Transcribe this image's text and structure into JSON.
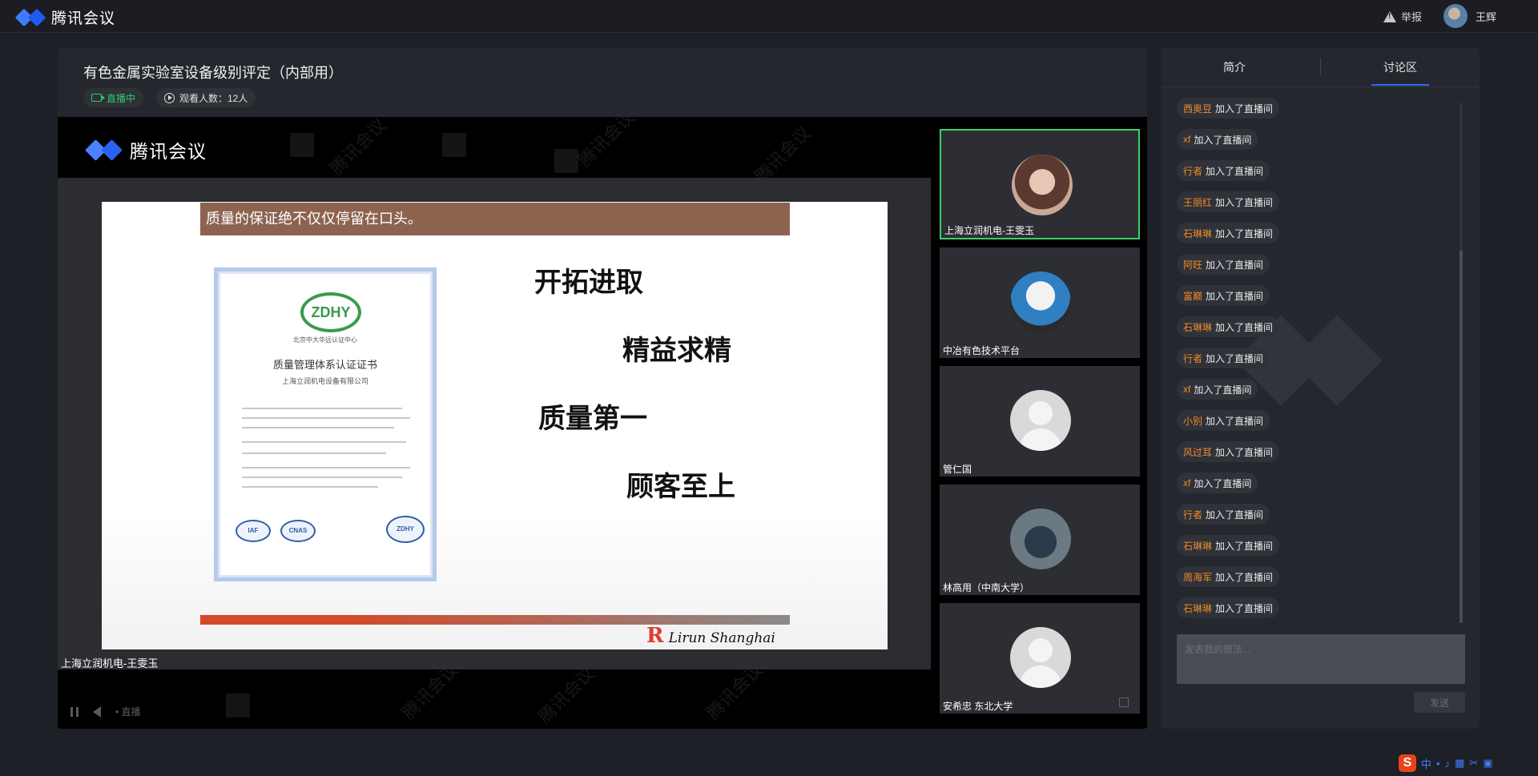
{
  "app": {
    "logo_text": "腾讯会议",
    "report_label": "举报",
    "user_name": "王辉"
  },
  "meeting": {
    "title": "有色金属实验室设备级别评定（内部用）",
    "live_label": "直播中",
    "viewers_label": "观看人数：12人"
  },
  "video": {
    "logo_text": "腾讯会议",
    "slide_header": "质量的保证绝不仅仅停留在口头。",
    "mottos": [
      "开拓进取",
      "精益求精",
      "质量第一",
      "顾客至上"
    ],
    "certificate": {
      "logo": "ZDHY",
      "org": "北京中大华远认证中心",
      "title": "质量管理体系认证证书",
      "company": "上海立润机电设备有限公司",
      "badges": [
        "IAF",
        "CNAS",
        "ZDHY"
      ]
    },
    "brand": "Lirun Shanghai",
    "speaker_label": "上海立润机电-王雯玉",
    "control_text": "• 直播",
    "watermark": "腾讯会议"
  },
  "participants": [
    {
      "name": "上海立润机电-王雯玉",
      "active": true,
      "avatar": "photo"
    },
    {
      "name": "中冶有色技术平台",
      "active": false,
      "avatar": "cartoon"
    },
    {
      "name": "管仁国",
      "active": false,
      "avatar": "default"
    },
    {
      "name": "林高用（中南大学）",
      "active": false,
      "avatar": "photo"
    },
    {
      "name": "安希忠 东北大学",
      "active": false,
      "avatar": "default"
    }
  ],
  "side": {
    "tab_intro": "简介",
    "tab_discussion": "讨论区",
    "chat": [
      {
        "name": "西奥豆",
        "text": "加入了直播间"
      },
      {
        "name": "xf",
        "text": "加入了直播间"
      },
      {
        "name": "行者",
        "text": "加入了直播间"
      },
      {
        "name": "王丽红",
        "text": "加入了直播间"
      },
      {
        "name": "石琳琳",
        "text": "加入了直播间"
      },
      {
        "name": "阿旺",
        "text": "加入了直播间"
      },
      {
        "name": "富巅",
        "text": "加入了直播间"
      },
      {
        "name": "石琳琳",
        "text": "加入了直播间"
      },
      {
        "name": "行者",
        "text": "加入了直播间"
      },
      {
        "name": "xf",
        "text": "加入了直播间"
      },
      {
        "name": "小别",
        "text": "加入了直播间"
      },
      {
        "name": "风过耳",
        "text": "加入了直播间"
      },
      {
        "name": "xf",
        "text": "加入了直播间"
      },
      {
        "name": "行者",
        "text": "加入了直播间"
      },
      {
        "name": "石琳琳",
        "text": "加入了直播间"
      },
      {
        "name": "周海军",
        "text": "加入了直播间"
      },
      {
        "name": "石琳琳",
        "text": "加入了直播间"
      }
    ],
    "input_placeholder": "发表我的想法...",
    "send_label": "发送"
  },
  "ime": {
    "label": "中"
  },
  "colors": {
    "accent": "#2d6ef6",
    "live": "#2fc773",
    "chat_name": "#f08a2c",
    "active_tile": "#3ecf6a"
  }
}
